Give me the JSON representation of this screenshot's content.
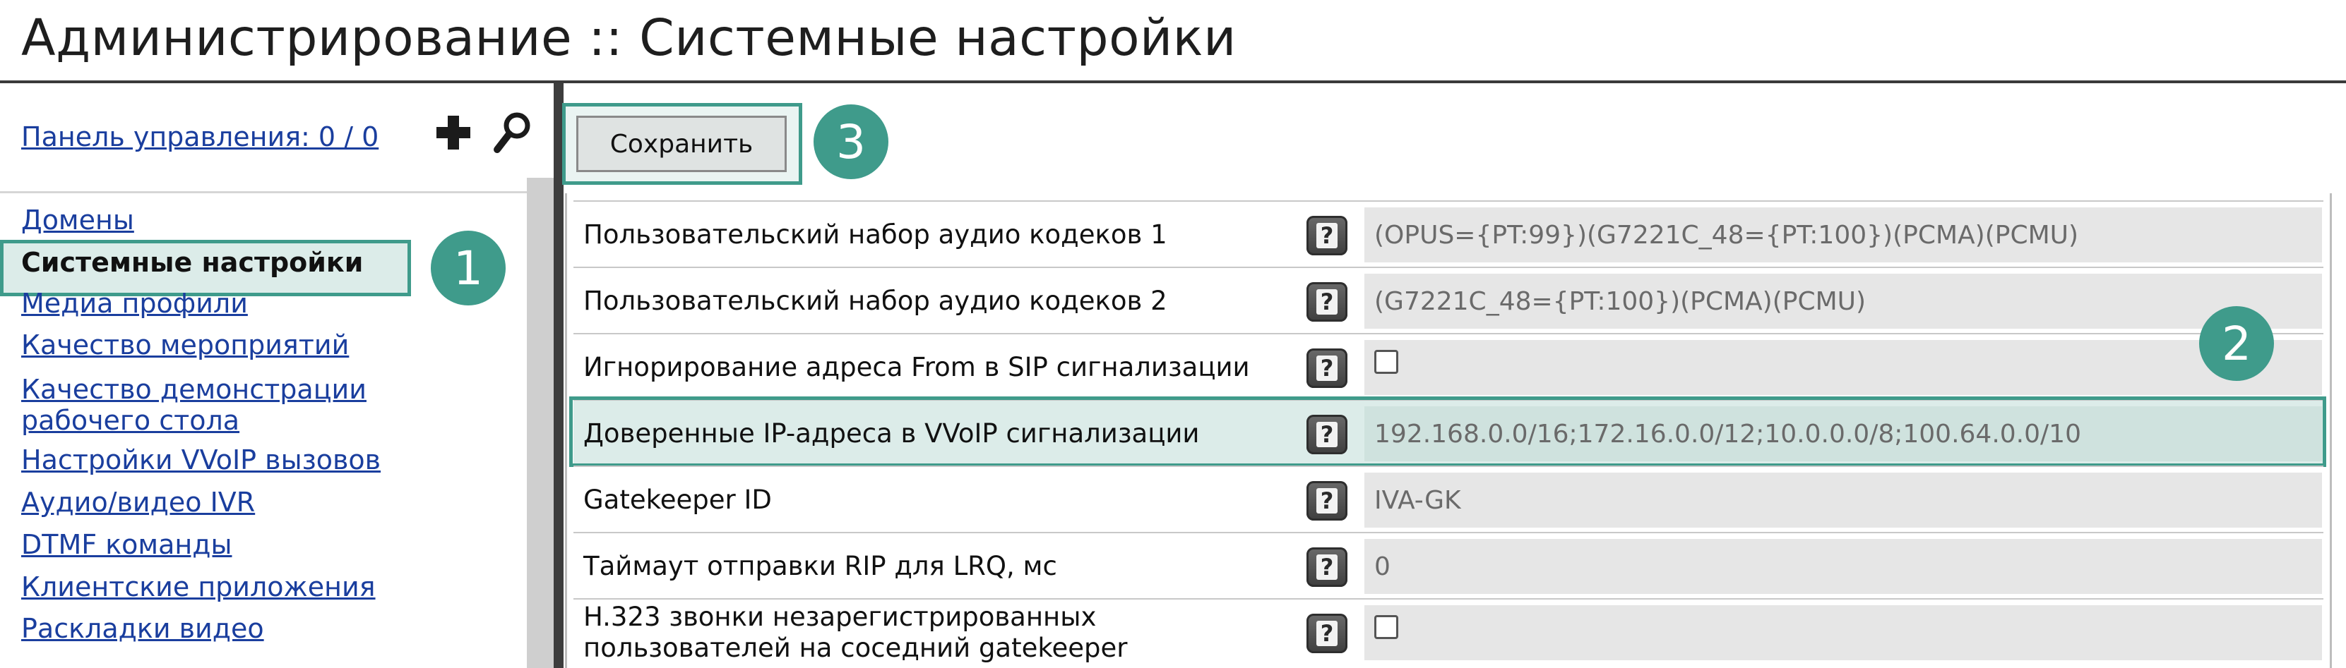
{
  "page": {
    "title": "Администрирование :: Системные настройки"
  },
  "left_panel": {
    "panel_link": "Панель управления: 0 / 0",
    "add_icon": "plus-icon",
    "search_icon": "search-icon",
    "nav_items": [
      {
        "label": "Домены"
      },
      {
        "label": "Системные настройки",
        "active": true
      },
      {
        "label": "Медиа профили"
      },
      {
        "label": "Качество мероприятий"
      },
      {
        "label": "Качество демонстрации рабочего стола"
      },
      {
        "label": "Настройки VVoIP вызовов"
      },
      {
        "label": "Аудио/видео IVR"
      },
      {
        "label": "DTMF команды"
      },
      {
        "label": "Клиентские приложения"
      },
      {
        "label": "Раскладки видео"
      }
    ]
  },
  "toolbar": {
    "save_label": "Сохранить"
  },
  "callouts": [
    "1",
    "2",
    "3"
  ],
  "settings": [
    {
      "label": "Пользовательский набор аудио кодеков 1",
      "value": "(OPUS={PT:99})(G7221C_48={PT:100})(PCMA)(PCMU)"
    },
    {
      "label": "Пользовательский набор аудио кодеков 2",
      "value": "(G7221C_48={PT:100})(PCMA)(PCMU)"
    },
    {
      "label": "Игнорирование адреса From в SIP сигнализации",
      "checkbox": false
    },
    {
      "label": "Доверенные IP-адреса в VVoIP сигнализации",
      "value": "192.168.0.0/16;172.16.0.0/12;10.0.0.0/8;100.64.0.0/10",
      "highlighted": true
    },
    {
      "label": "Gatekeeper ID",
      "value": "IVA-GK"
    },
    {
      "label": "Таймаут отправки RIP для LRQ, мс",
      "value": "0"
    },
    {
      "label": "H.323 звонки незарегистрированных пользователей на соседний gatekeeper",
      "checkbox": false
    }
  ],
  "help_glyph": "?",
  "colors": {
    "accent": "#3f9b8b",
    "highlight_bg": "#dcece9",
    "link": "#1a3e9e"
  }
}
